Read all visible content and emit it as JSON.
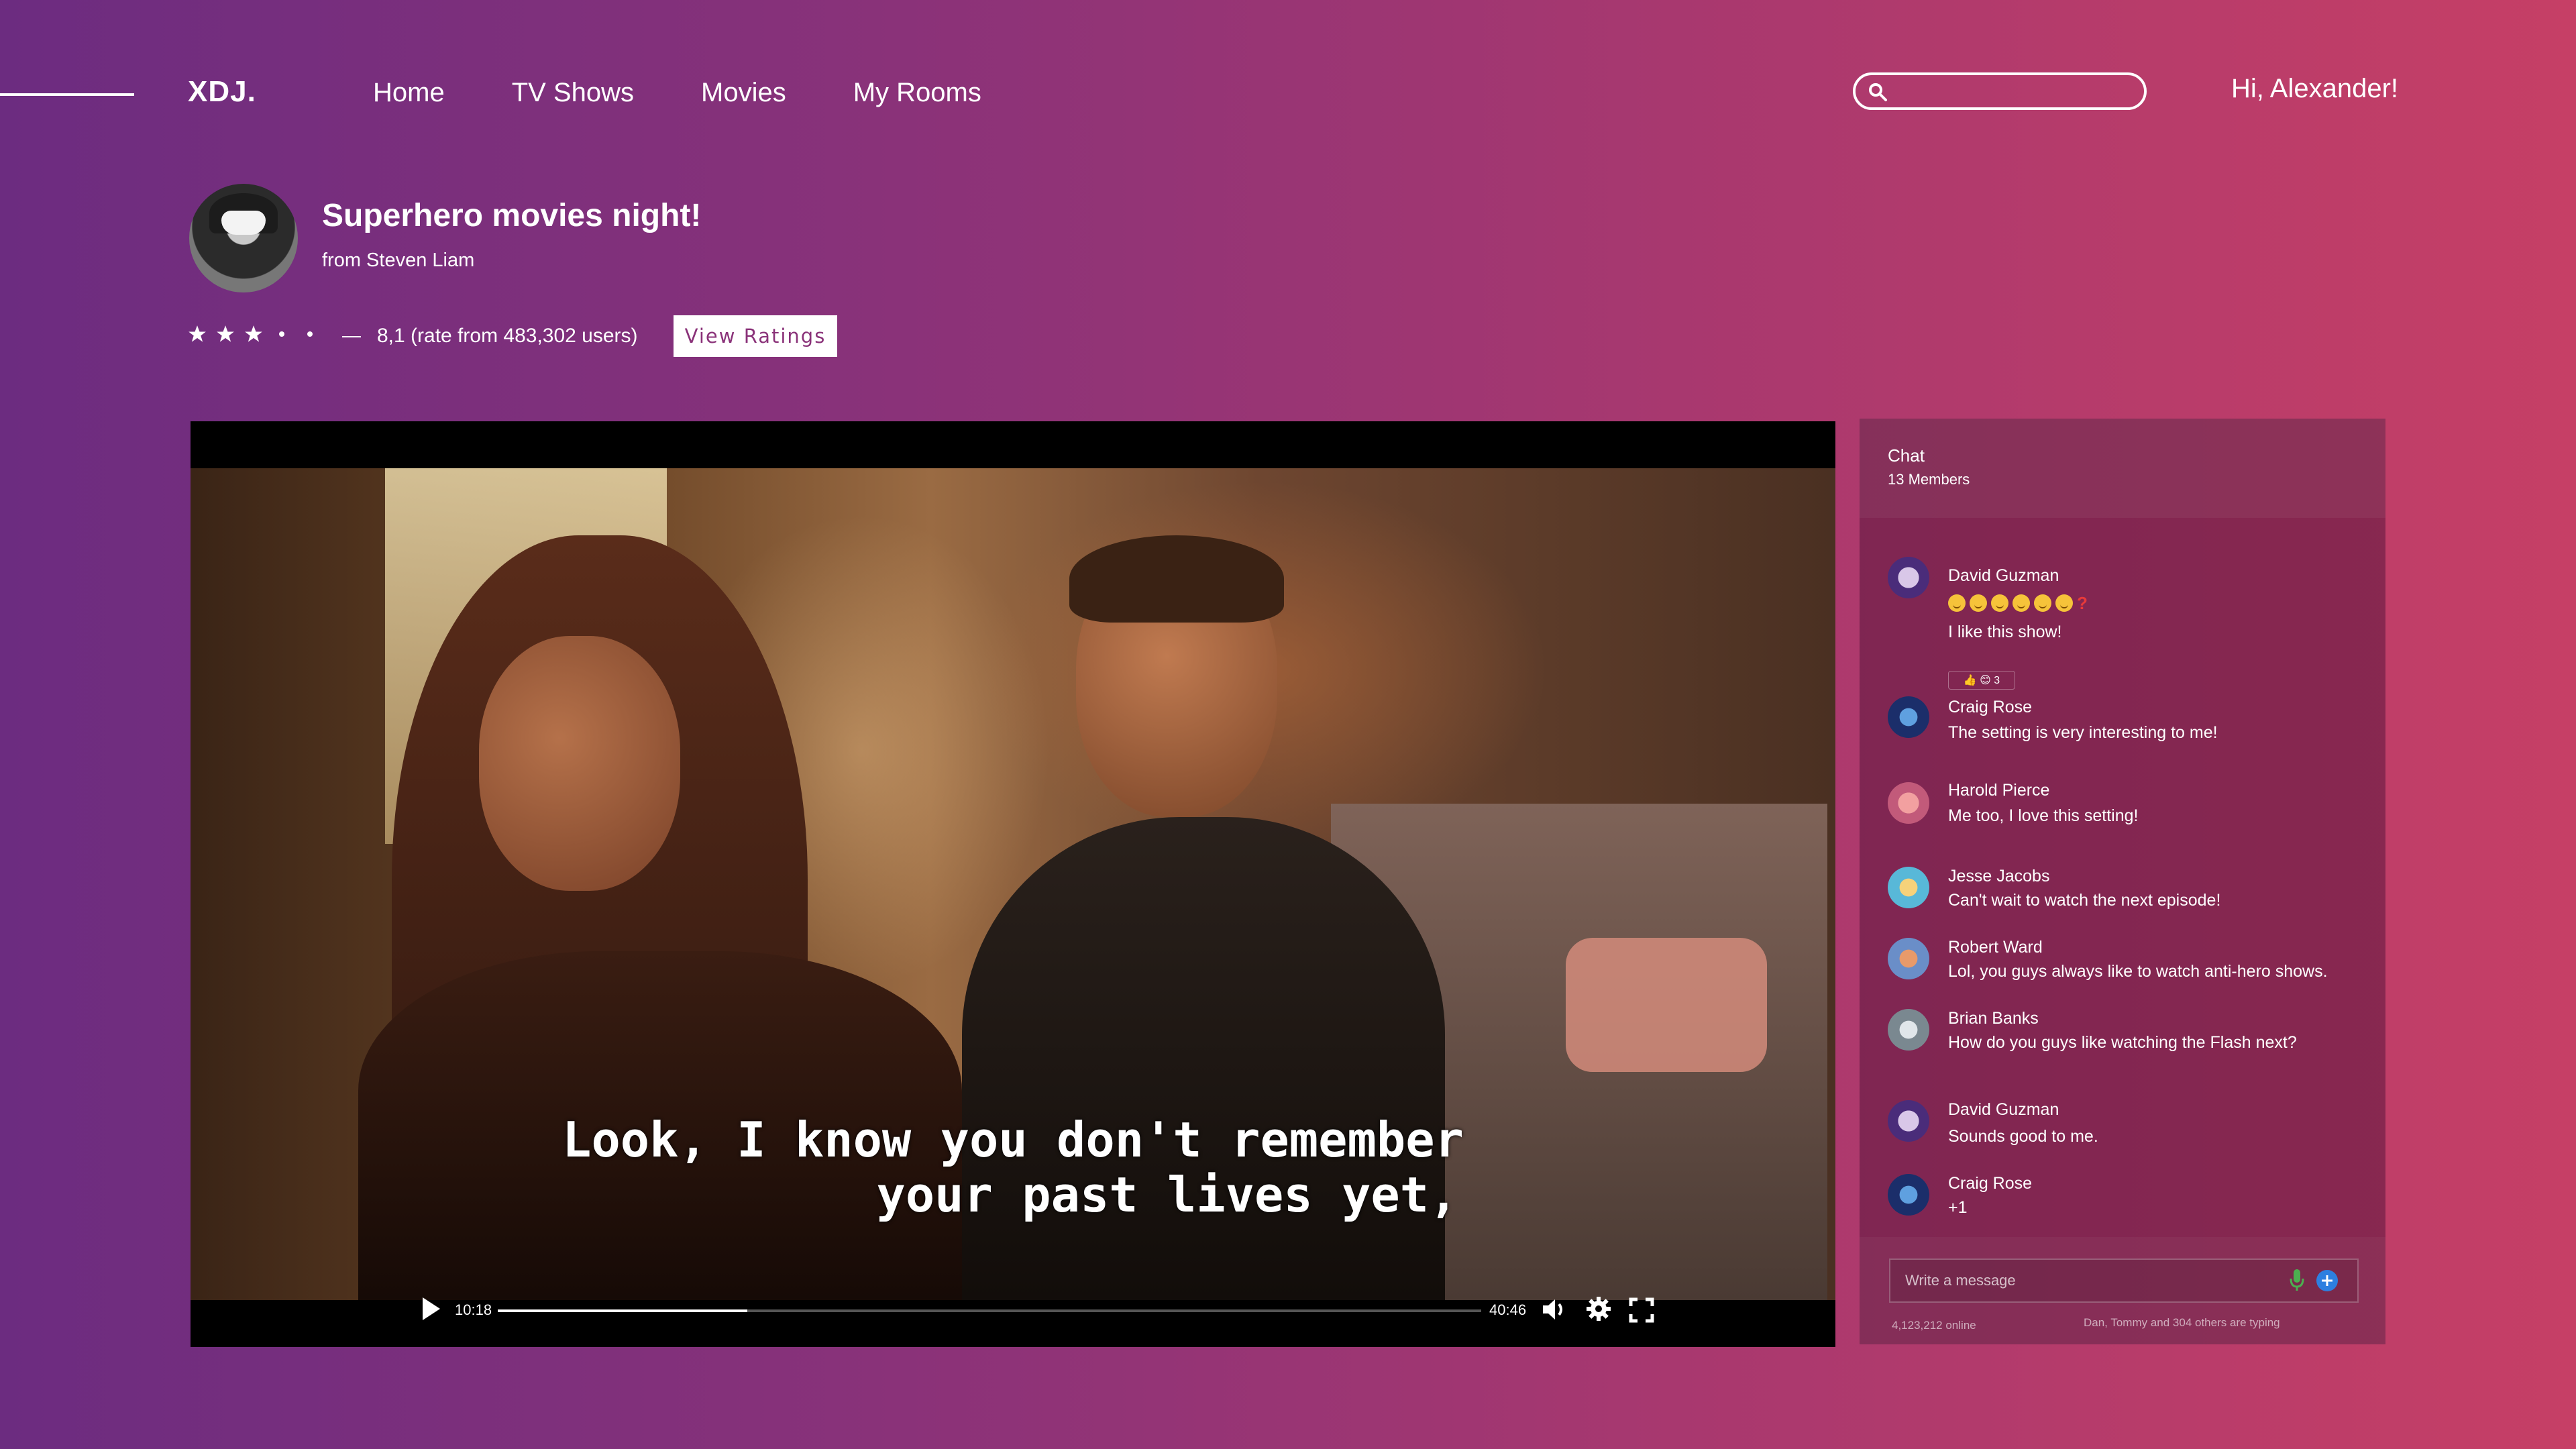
{
  "header": {
    "logo": "XDJ.",
    "nav": [
      "Home",
      "TV Shows",
      "Movies",
      "My Rooms"
    ],
    "search": {
      "value": "",
      "placeholder": ""
    },
    "greeting": "Hi, Alexander!"
  },
  "room": {
    "title": "Superhero movies night!",
    "host": "from Steven Liam",
    "stars_filled": 3,
    "stars_total": 5,
    "rating_text": "8,1 (rate from 483,302 users)",
    "view_ratings_label": "View Ratings"
  },
  "player": {
    "subtitle_line1": "Look, I know you don't remember",
    "subtitle_line2": "your past lives yet,",
    "current_time": "10:18",
    "total_time": "40:46",
    "progress": 0.254
  },
  "chat": {
    "title": "Chat",
    "members": "13 Members",
    "messages": [
      {
        "name": "David Guzman",
        "text": "I like this show!"
      },
      {
        "name": "Craig Rose",
        "text": "The setting is very interesting to me!",
        "reaction": "👍 😊 3"
      },
      {
        "name": "Harold Pierce",
        "text": "Me too, I love this setting!"
      },
      {
        "name": "Jesse Jacobs",
        "text": "Can't wait to watch the next episode!"
      },
      {
        "name": "Robert Ward",
        "text": "Lol, you guys always like to watch anti-hero shows."
      },
      {
        "name": "Brian Banks",
        "text": "How do you guys like watching the Flash next?"
      },
      {
        "name": "David Guzman",
        "text": "Sounds good to me."
      },
      {
        "name": "Craig Rose",
        "text": "+1"
      }
    ],
    "input_placeholder": "Write a message",
    "online": "4,123,212 online",
    "typing": "Dan, Tommy and 304 others are typing"
  },
  "colors": {
    "bg_left": "#6c2c80",
    "bg_right": "#c63f66",
    "accent": "#8a3279",
    "mic": "#4caf50",
    "plus": "#2d7fe0"
  }
}
